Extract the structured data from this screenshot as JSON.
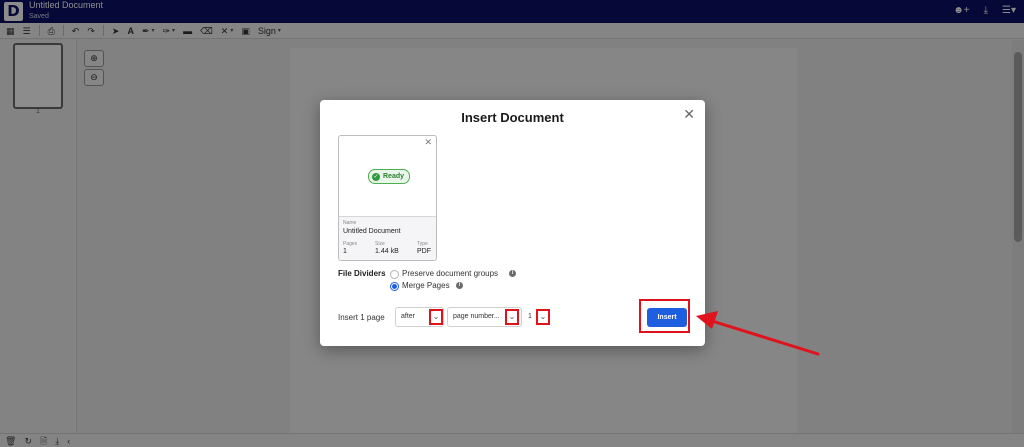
{
  "header": {
    "logo_letter": "D",
    "doc_title": "Untitled Document",
    "doc_status": "Saved",
    "icons": [
      "add-user-icon",
      "download-icon",
      "menu-icon"
    ]
  },
  "toolbar": {
    "sign_label": "Sign",
    "icons": [
      "grid-view-icon",
      "list-view-icon",
      "print-icon",
      "undo-icon",
      "redo-icon",
      "select-pointer-icon",
      "text-icon",
      "pen-icon",
      "highlighter-icon",
      "comment-icon",
      "eraser-icon",
      "close-x-icon",
      "image-icon"
    ]
  },
  "thumbnails": {
    "pages": [
      {
        "number": "1"
      }
    ]
  },
  "zoom": {
    "in_icon": "zoom-in-icon",
    "out_icon": "zoom-out-icon"
  },
  "bottom_bar": {
    "icons": [
      "delete-icon",
      "rotate-icon",
      "file-icon",
      "download-icon",
      "collapse-left-icon"
    ]
  },
  "modal": {
    "title": "Insert Document",
    "close_icon": "close-icon",
    "document": {
      "status": "Ready",
      "name_label": "Name",
      "name": "Untitled Document",
      "pages_label": "Pages",
      "pages": "1",
      "size_label": "Size",
      "size": "1.44 kB",
      "type_label": "Type",
      "type": "PDF"
    },
    "file_dividers": {
      "label": "File Dividers",
      "options": [
        {
          "label": "Preserve document groups",
          "checked": false
        },
        {
          "label": "Merge Pages",
          "checked": true
        }
      ]
    },
    "insert_row": {
      "label": "Insert 1 page",
      "position": "after",
      "reference": "page number...",
      "page_number": "1",
      "button_label": "Insert"
    }
  },
  "annotations": {
    "highlight_color": "#e0121c",
    "accent_color": "#1d5fde"
  }
}
